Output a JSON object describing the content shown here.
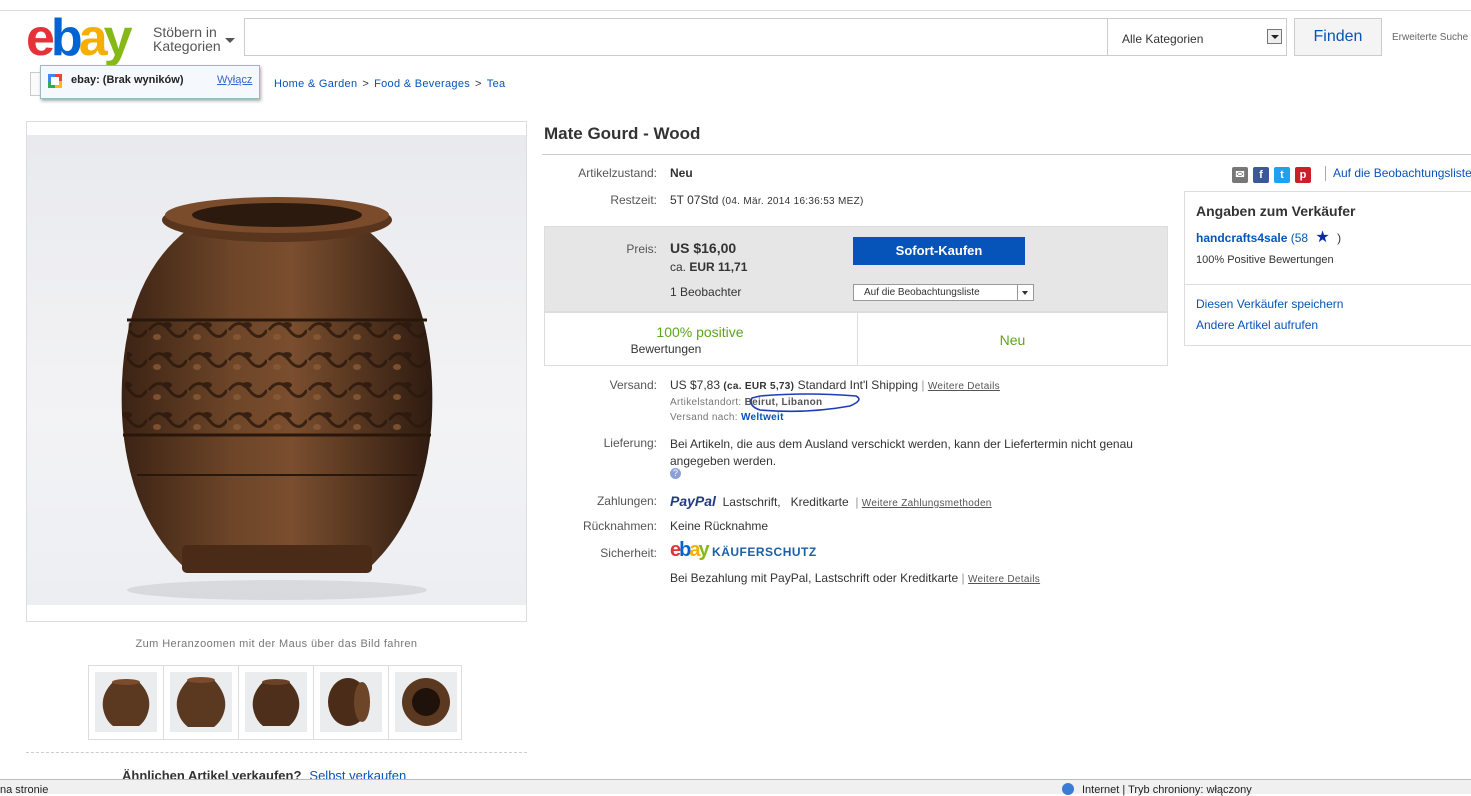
{
  "header": {
    "logo": {
      "e": "e",
      "b": "b",
      "a": "a",
      "y": "y"
    },
    "browse_line1": "Stöbern in",
    "browse_line2": "Kategorien",
    "search_placeholder": "",
    "category_select": "Alle Kategorien",
    "find_button": "Finden",
    "advanced_search": "Erweiterte Suche"
  },
  "popup": {
    "text": "ebay: (Brak wyników)",
    "off_link": "Wyłącz"
  },
  "breadcrumb": [
    {
      "label": "Home & Garden"
    },
    {
      "label": "Food & Beverages"
    },
    {
      "label": "Tea"
    }
  ],
  "breadcrumb_sep": ">",
  "gallery": {
    "zoom_hint": "Zum Heranzoomen mit der Maus über das Bild fahren",
    "thumb_count": 5
  },
  "sell_similar": {
    "text": "Ähnlichen Artikel verkaufen?",
    "link": "Selbst verkaufen"
  },
  "item": {
    "title": "Mate Gourd - Wood",
    "condition_label": "Artikelzustand:",
    "condition_value": "Neu",
    "time_label": "Restzeit:",
    "time_value": "5T 07Std",
    "time_end": "(04. Mär. 2014  16:36:53 MEZ)",
    "price_label": "Preis:",
    "price": "US $16,00",
    "price_eur_prefix": "ca.",
    "price_eur": "EUR 11,71",
    "watchers": "1 Beobachter",
    "buy_button": "Sofort-Kaufen",
    "watch_select": "Auf die Beobachtungsliste",
    "rating_positive": "100% positive",
    "rating_label": "Bewertungen",
    "rating_condition": "Neu",
    "shipping_label": "Versand:",
    "shipping_cost": "US $7,83",
    "shipping_eur": "(ca. EUR 5,73)",
    "shipping_method": "Standard Int'l Shipping",
    "shipping_sep": "|",
    "more_details": "Weitere Details",
    "location_label": "Artikelstandort:",
    "location_value": "Beirut, Libanon",
    "ships_to_label": "Versand nach:",
    "ships_to_value": "Weltweit",
    "delivery_label": "Lieferung:",
    "delivery_text": "Bei Artikeln, die aus dem Ausland verschickt werden, kann der Liefertermin nicht genau angegeben werden.",
    "payment_label": "Zahlungen:",
    "payment_paypal": "PayPal",
    "payment_methods": "Lastschrift,   Kreditkarte",
    "payment_more": "Weitere Zahlungsmethoden",
    "returns_label": "Rücknahmen:",
    "returns_value": "Keine Rücknahme",
    "security_label": "Sicherheit:",
    "protection": "KÄUFERSCHUTZ",
    "protection_text": "Bei Bezahlung mit PayPal, Lastschrift oder Kreditkarte",
    "protection_more": "Weitere Details"
  },
  "side": {
    "watchlist_link": "Auf die Beobachtungsliste",
    "seller_heading": "Angaben zum Verkäufer",
    "seller_name": "handcrafts4sale",
    "seller_score": "(58",
    "seller_score_close": ")",
    "seller_feedback": "100% Positive Bewertungen",
    "save_seller": "Diesen Verkäufer speichern",
    "other_items": "Andere Artikel aufrufen"
  },
  "statusbar": {
    "left": "na stronie",
    "right": "Internet | Tryb chroniony: włączony"
  },
  "colors": {
    "link_blue": "#0654ba",
    "buy_blue": "#0654ba",
    "positive_green": "#5ba71b",
    "price_box_gray": "#e6e6e6"
  }
}
